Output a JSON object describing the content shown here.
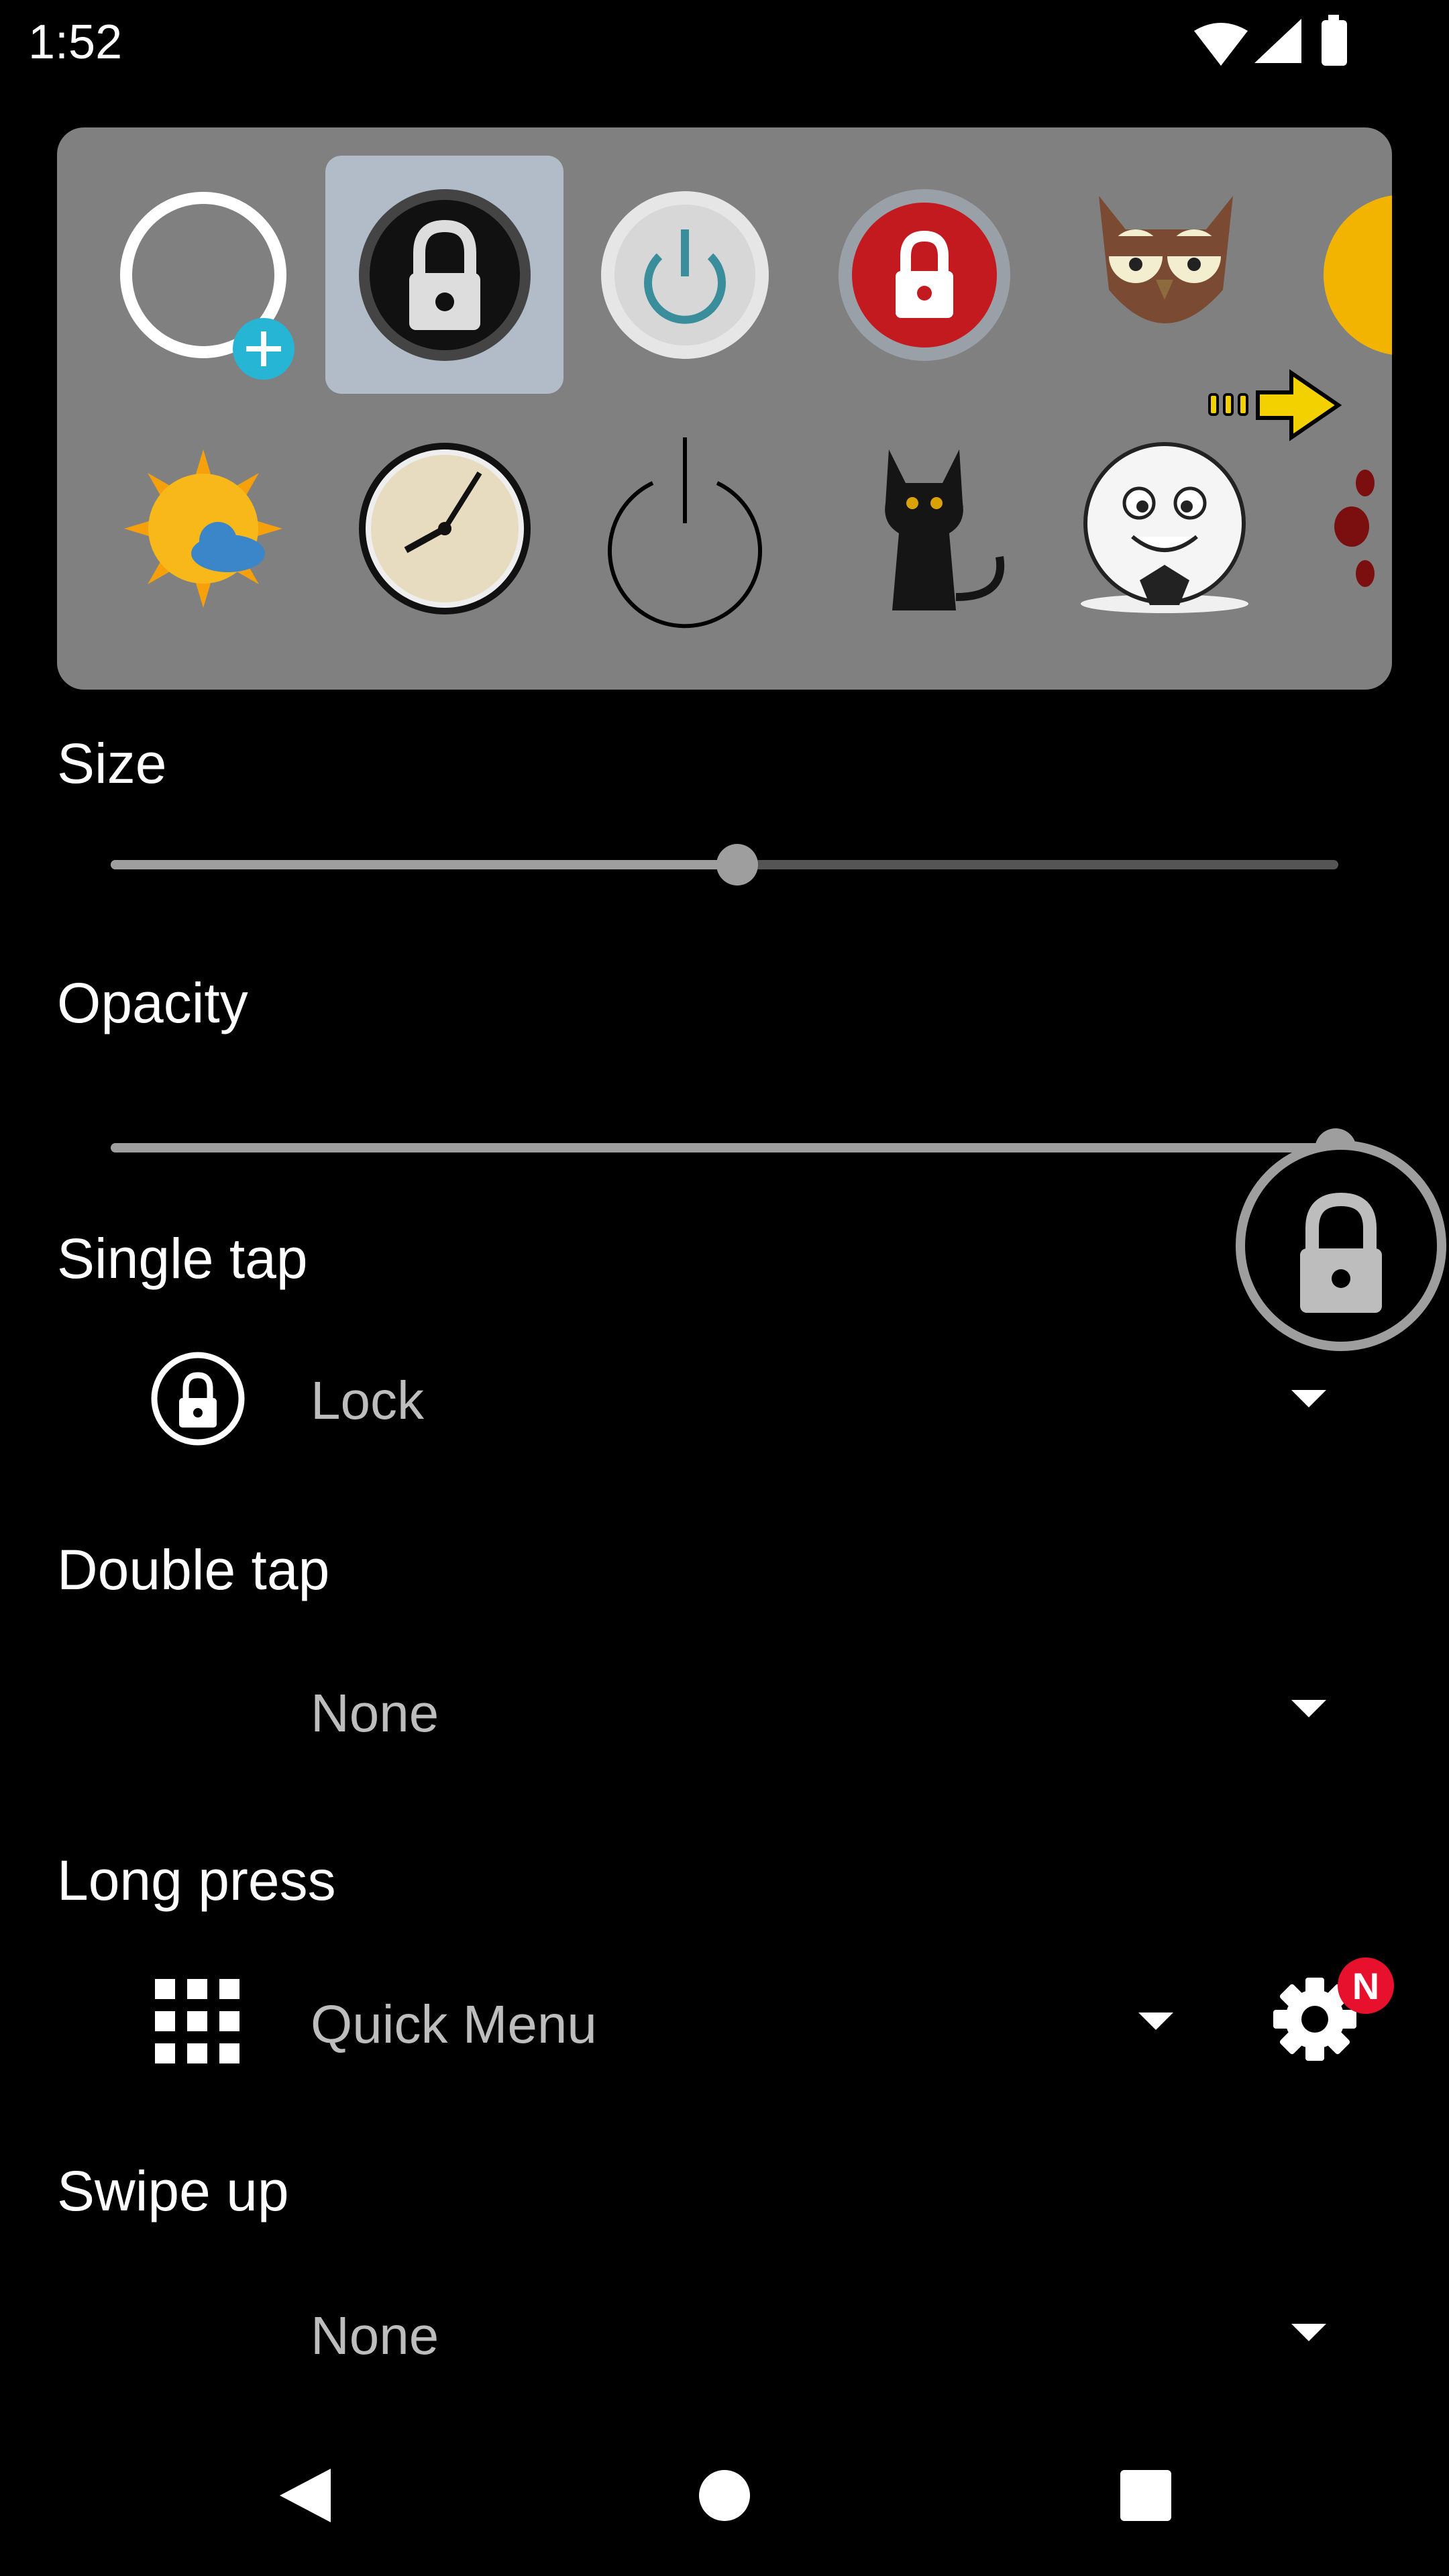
{
  "status_bar": {
    "time": "1:52"
  },
  "icon_panel": {
    "row1": [
      "add-custom-icon",
      "lock-black-icon",
      "power-silver-icon",
      "lock-red-icon",
      "owl-icon",
      "emoji-partial-icon"
    ],
    "row2": [
      "sun-cloud-icon",
      "clock-icon",
      "power-outline-icon",
      "cat-icon",
      "soccer-ball-icon",
      "partial-icon"
    ],
    "selected": "lock-black-icon"
  },
  "size": {
    "label": "Size",
    "value_fraction": 0.5
  },
  "opacity": {
    "label": "Opacity",
    "value_fraction": 1.0
  },
  "single_tap": {
    "label": "Single tap",
    "value": "Lock"
  },
  "double_tap": {
    "label": "Double tap",
    "value": "None"
  },
  "long_press": {
    "label": "Long press",
    "value": "Quick Menu",
    "badge": "N"
  },
  "swipe_up": {
    "label": "Swipe up",
    "value": "None"
  },
  "colors": {
    "panel": "#808080",
    "selected": "#b2bcc8",
    "accent_plus": "#26b5d5",
    "badge": "#e8112d"
  }
}
